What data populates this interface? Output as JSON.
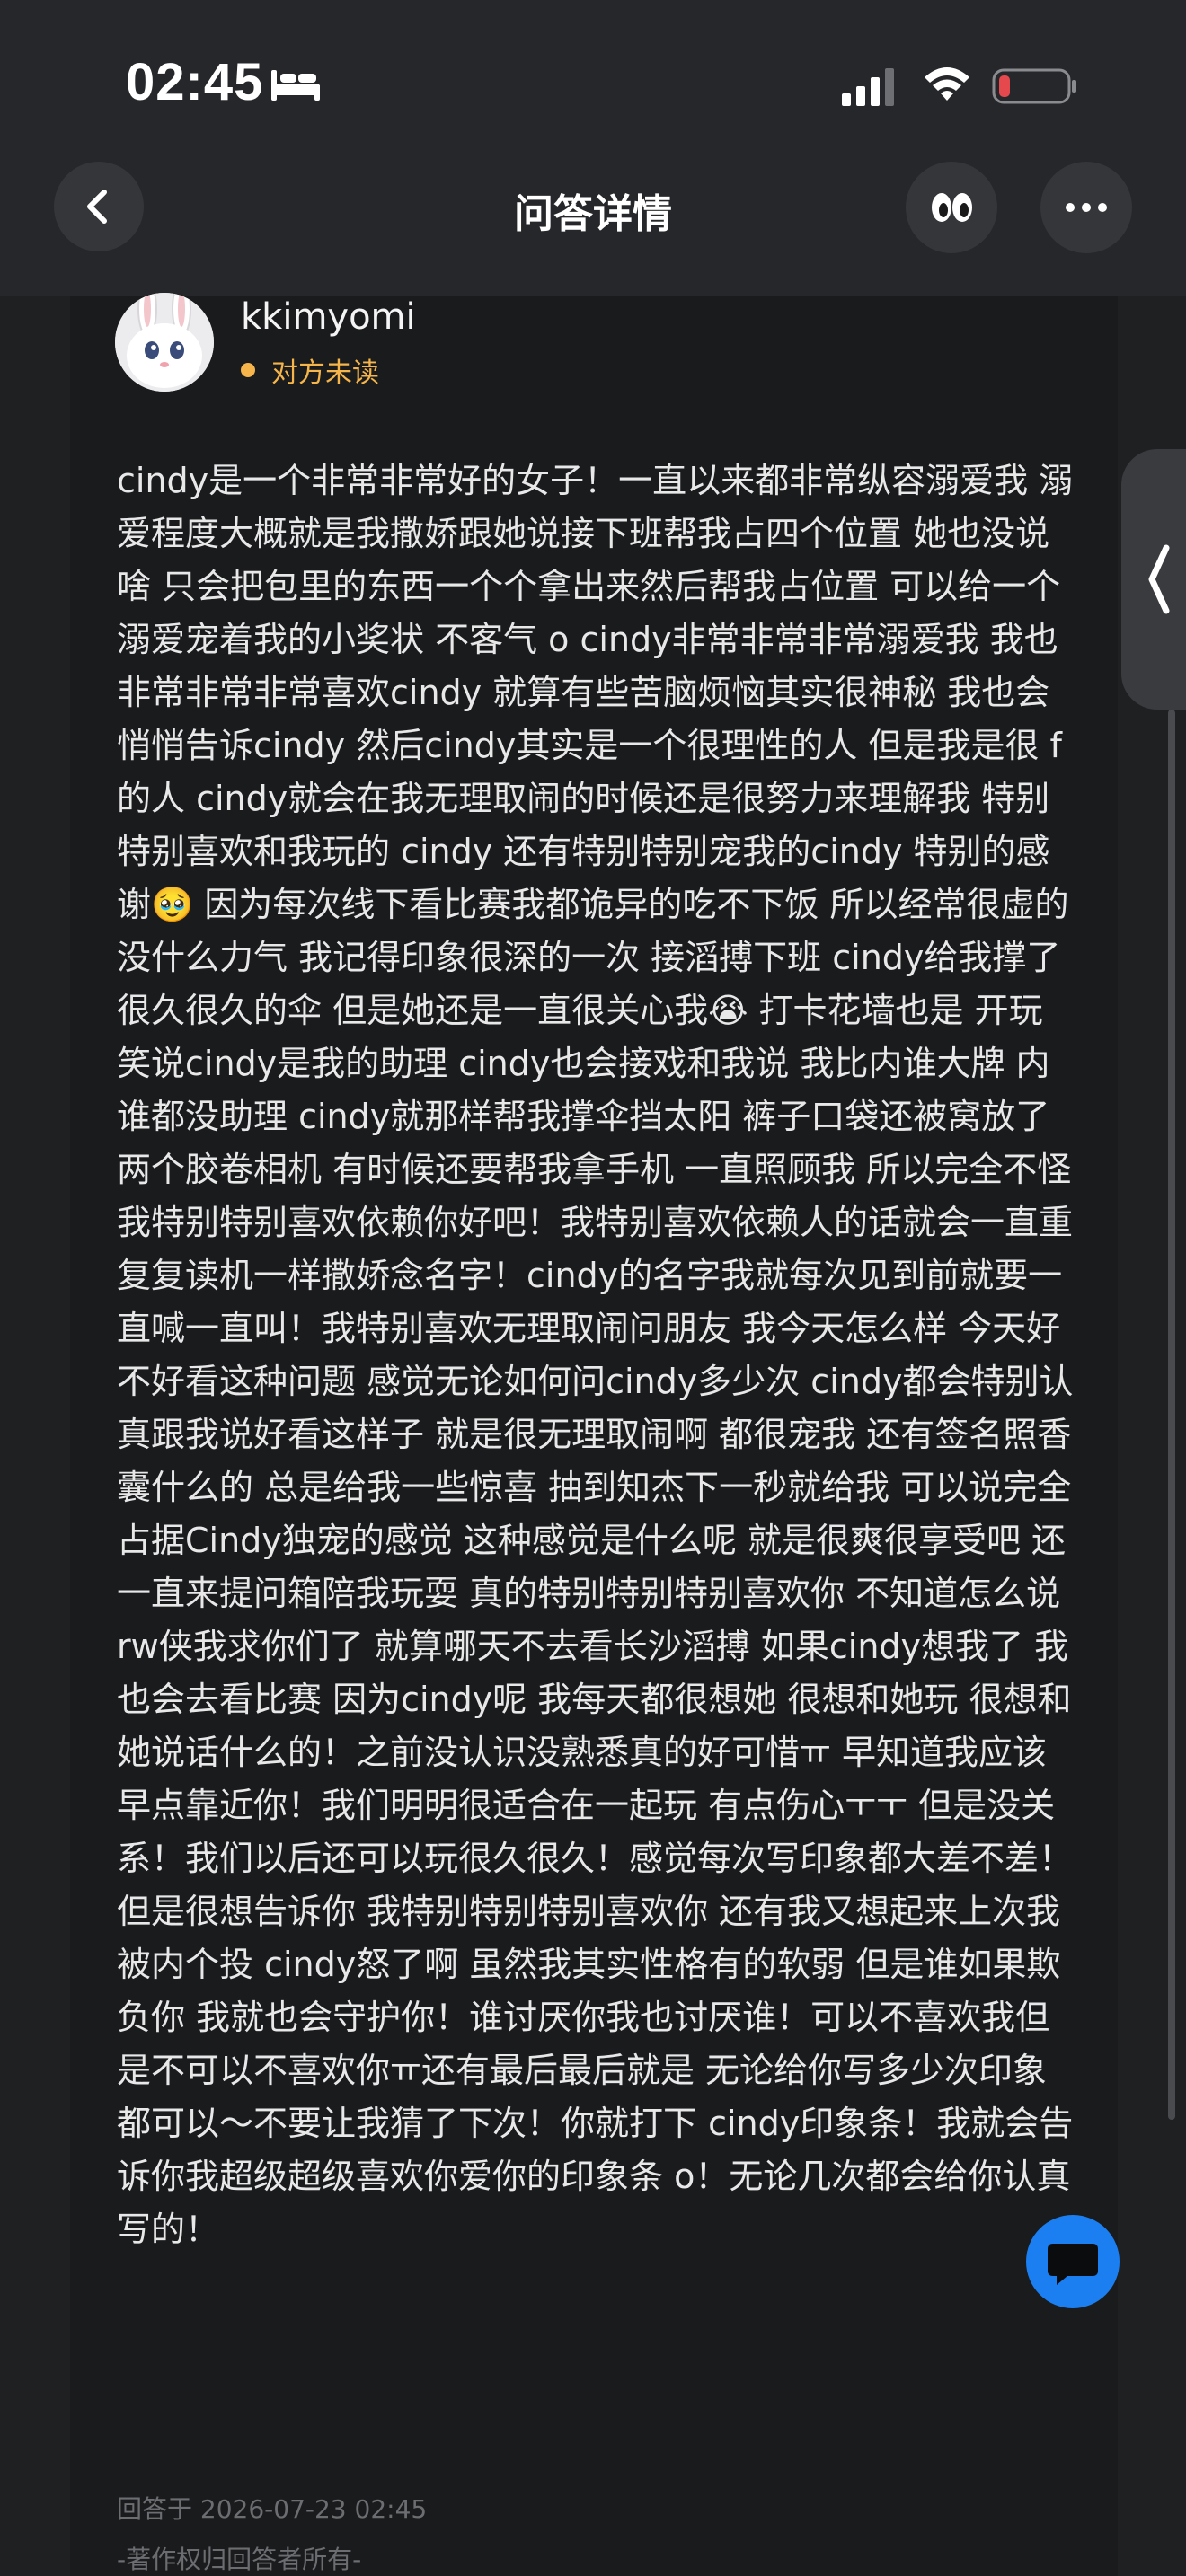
{
  "status_bar": {
    "time": "02:45",
    "icons": [
      "bed-icon",
      "signal-icon",
      "wifi-icon",
      "battery-low-icon"
    ],
    "battery_color": "#e5484d"
  },
  "nav": {
    "title": "问答详情",
    "icons": [
      "back-chevron-icon",
      "eyes-emoji-icon",
      "more-dots-icon"
    ]
  },
  "author": {
    "name": "kkimyomi",
    "read_status": "对方未读",
    "status_color": "#f5b54a",
    "avatar_icon": "white-rabbit-avatar"
  },
  "answer": {
    "text": "cindy是一个非常非常好的女子！一直以来都非常纵容溺爱我 溺爱程度大概就是我撒娇跟她说接下班帮我占四个位置 她也没说啥 只会把包里的东西一个个拿出来然后帮我占位置 可以给一个溺爱宠着我的小奖状 不客气 o cindy非常非常非常溺爱我 我也非常非常非常喜欢cindy 就算有些苦脑烦恼其实很神秘 我也会悄悄告诉cindy 然后cindy其实是一个很理性的人 但是我是很 f 的人 cindy就会在我无理取闹的时候还是很努力来理解我 特别特别喜欢和我玩的 cindy 还有特别特别宠我的cindy 特别的感谢🥹 因为每次线下看比赛我都诡异的吃不下饭 所以经常很虚的没什么力气 我记得印象很深的一次 接滔搏下班 cindy给我撑了很久很久的伞 但是她还是一直很关心我😭 打卡花墙也是 开玩笑说cindy是我的助理 cindy也会接戏和我说 我比内谁大牌 内谁都没助理 cindy就那样帮我撑伞挡太阳 裤子口袋还被窝放了两个胶卷相机 有时候还要帮我拿手机 一直照顾我 所以完全不怪我特别特别喜欢依赖你好吧！我特别喜欢依赖人的话就会一直重复复读机一样撒娇念名字！cindy的名字我就每次见到前就要一直喊一直叫！我特别喜欢无理取闹问朋友 我今天怎么样 今天好不好看这种问题 感觉无论如何问cindy多少次 cindy都会特别认真跟我说好看这样子 就是很无理取闹啊 都很宠我 还有签名照香囊什么的 总是给我一些惊喜 抽到知杰下一秒就给我 可以说完全占据Cindy独宠的感觉 这种感觉是什么呢 就是很爽很享受吧 还一直来提问箱陪我玩耍 真的特别特别特别喜欢你 不知道怎么说 rw侠我求你们了 就算哪天不去看长沙滔搏 如果cindy想我了 我也会去看比赛 因为cindy呢 我每天都很想她 很想和她玩 很想和她说话什么的！之前没认识没熟悉真的好可惜ㅠ 早知道我应该早点靠近你！我们明明很适合在一起玩 有点伤心ㅜㅜ 但是没关系！我们以后还可以玩很久很久！感觉每次写印象都大差不差！但是很想告诉你 我特别特别特别喜欢你 还有我又想起来上次我被内个投 cindy怒了啊 虽然我其实性格有的软弱 但是谁如果欺负你 我就也会守护你！谁讨厌你我也讨厌谁！可以不喜欢我但是不可以不喜欢你ㅠ还有最后最后就是 无论给你写多少次印象都可以～不要让我猜了下次！你就打下 cindy印象条！我就会告诉你我超级超级喜欢你爱你的印象条 o！无论几次都会给你认真写的！",
    "answered_at": "回答于 2026-07-23 02:45",
    "copyright": "-著作权归回答者所有-"
  },
  "side_tab": {
    "icon": "chevron-left-icon"
  },
  "fab": {
    "icon": "chat-bubble-icon",
    "color": "#1b7ff2"
  }
}
